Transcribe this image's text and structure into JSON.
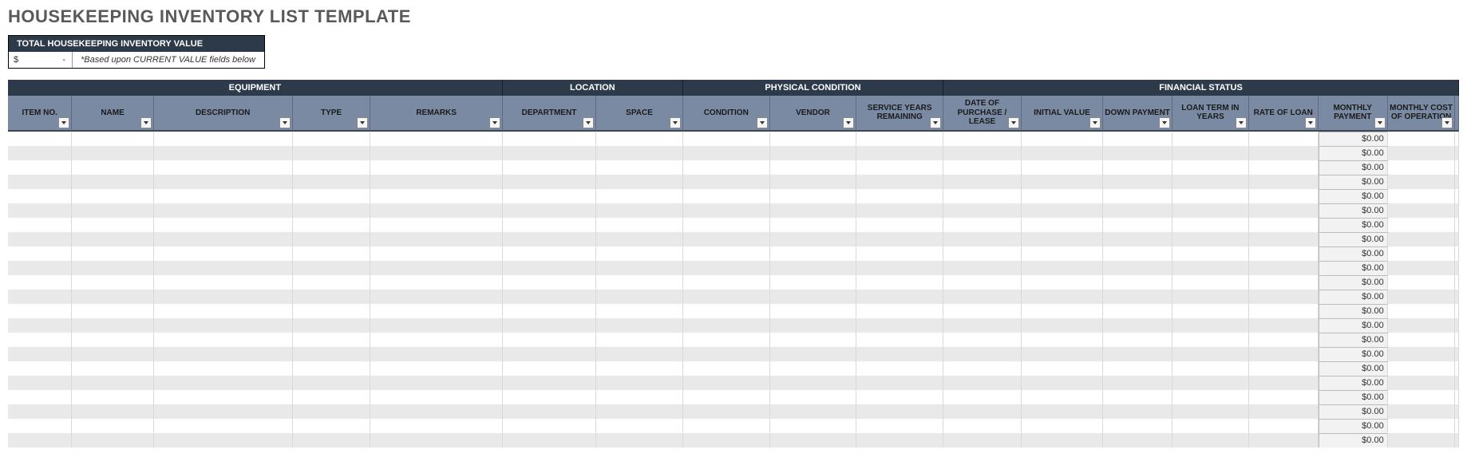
{
  "title": "HOUSEKEEPING INVENTORY LIST TEMPLATE",
  "total": {
    "header": "TOTAL HOUSEKEEPING INVENTORY VALUE",
    "currency_symbol": "$",
    "value_display": "-",
    "note": "*Based upon CURRENT VALUE fields below"
  },
  "groups": {
    "equipment": "EQUIPMENT",
    "location": "LOCATION",
    "condition": "PHYSICAL CONDITION",
    "financial": "FINANCIAL STATUS"
  },
  "columns": {
    "item_no": "ITEM NO.",
    "name": "NAME",
    "description": "DESCRIPTION",
    "type": "TYPE",
    "remarks": "REMARKS",
    "department": "DEPARTMENT",
    "space": "SPACE",
    "condition": "CONDITION",
    "vendor": "VENDOR",
    "service_years": "SERVICE YEARS REMAINING",
    "date_purchase": "DATE OF PURCHASE / LEASE",
    "initial_value": "INITIAL VALUE",
    "down_payment": "DOWN PAYMENT",
    "loan_term": "LOAN TERM IN YEARS",
    "rate_of_loan": "RATE OF LOAN",
    "monthly_payment": "MONTHLY PAYMENT",
    "monthly_cost": "MONTHLY COST OF OPERATION"
  },
  "rows": [
    {
      "monthly_payment": "$0.00"
    },
    {
      "monthly_payment": "$0.00"
    },
    {
      "monthly_payment": "$0.00"
    },
    {
      "monthly_payment": "$0.00"
    },
    {
      "monthly_payment": "$0.00"
    },
    {
      "monthly_payment": "$0.00"
    },
    {
      "monthly_payment": "$0.00"
    },
    {
      "monthly_payment": "$0.00"
    },
    {
      "monthly_payment": "$0.00"
    },
    {
      "monthly_payment": "$0.00"
    },
    {
      "monthly_payment": "$0.00"
    },
    {
      "monthly_payment": "$0.00"
    },
    {
      "monthly_payment": "$0.00"
    },
    {
      "monthly_payment": "$0.00"
    },
    {
      "monthly_payment": "$0.00"
    },
    {
      "monthly_payment": "$0.00"
    },
    {
      "monthly_payment": "$0.00"
    },
    {
      "monthly_payment": "$0.00"
    },
    {
      "monthly_payment": "$0.00"
    },
    {
      "monthly_payment": "$0.00"
    },
    {
      "monthly_payment": "$0.00"
    },
    {
      "monthly_payment": "$0.00"
    }
  ]
}
